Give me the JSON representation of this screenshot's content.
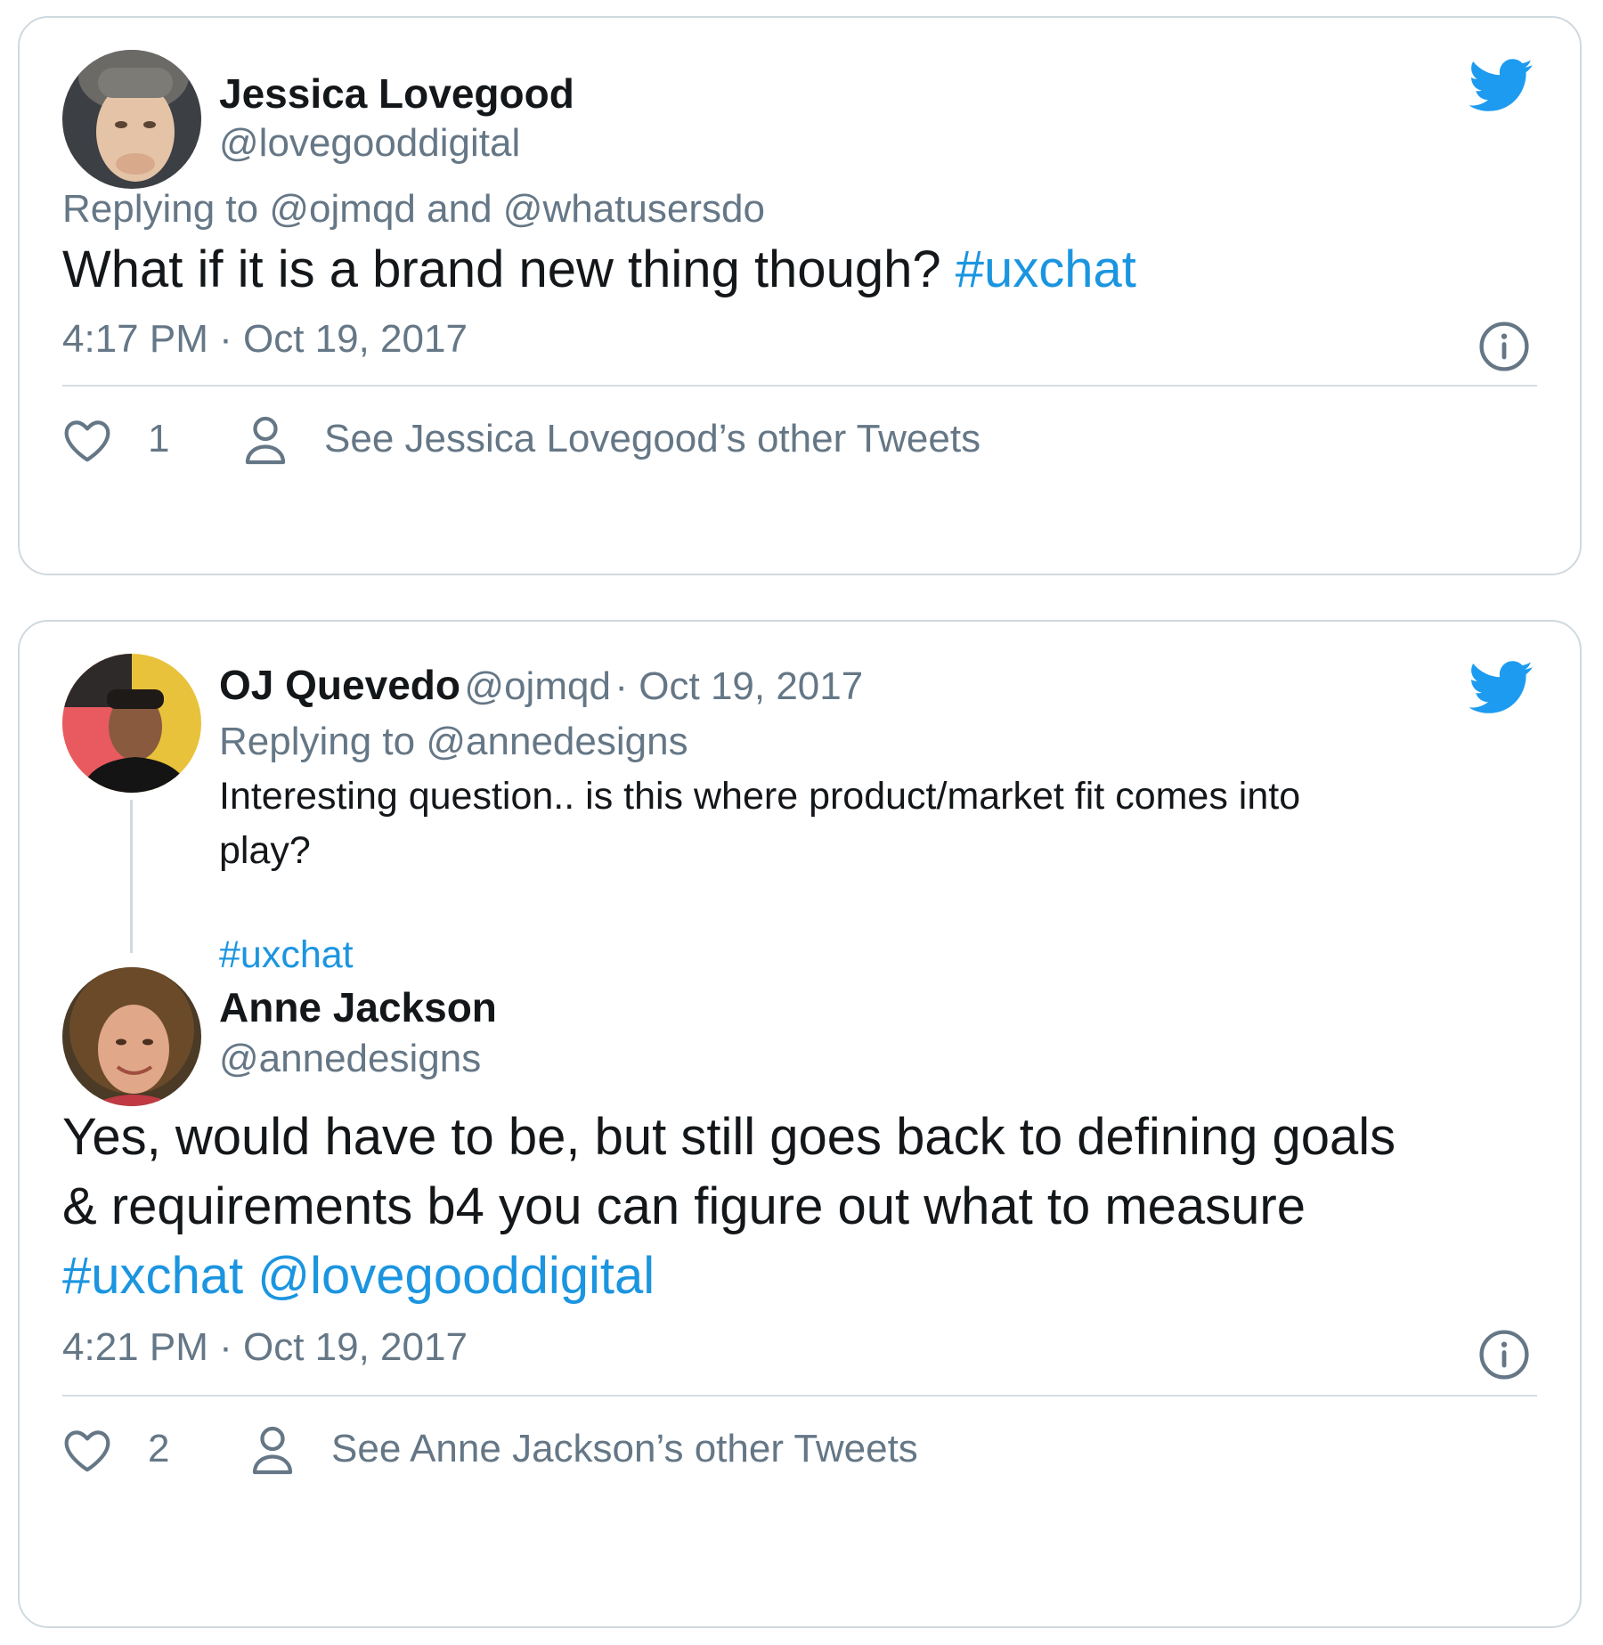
{
  "tweet1": {
    "author_name": "Jessica Lovegood",
    "author_handle": "@lovegooddigital",
    "reply_prefix": "Replying to",
    "reply_to_1": "@ojmqd",
    "reply_and": "and",
    "reply_to_2": "@whatusersdo",
    "text": "What if it is a brand new thing though?",
    "hashtag": "#uxchat",
    "timestamp": "4:17 PM · Oct 19, 2017",
    "like_count": "1",
    "see_other": "See Jessica Lovegood’s other Tweets"
  },
  "tweet2": {
    "parent": {
      "author_name": "OJ Quevedo",
      "author_handle": "@ojmqd",
      "date": "· Oct 19, 2017",
      "reply_prefix": "Replying to",
      "reply_to": "@annedesigns",
      "text_line1": "Interesting question.. is this where product/market fit comes into",
      "text_line2": "play?",
      "hashtag": "#uxchat"
    },
    "author_name": "Anne Jackson",
    "author_handle": "@annedesigns",
    "text_line1": "Yes, would have to be, but still goes back to defining goals",
    "text_line2": "& requirements b4 you can figure out what to measure",
    "hashtag": "#uxchat",
    "mention": "@lovegooddigital",
    "timestamp": "4:21 PM · Oct 19, 2017",
    "like_count": "2",
    "see_other": "See Anne Jackson’s other Tweets"
  },
  "colors": {
    "link_blue": "#1b95e0",
    "muted_gray": "#657786",
    "border": "#cfd9de",
    "twitter_blue": "#1d9bf0"
  },
  "icons": [
    "twitter-bird-icon",
    "info-icon",
    "heart-icon",
    "person-icon"
  ]
}
